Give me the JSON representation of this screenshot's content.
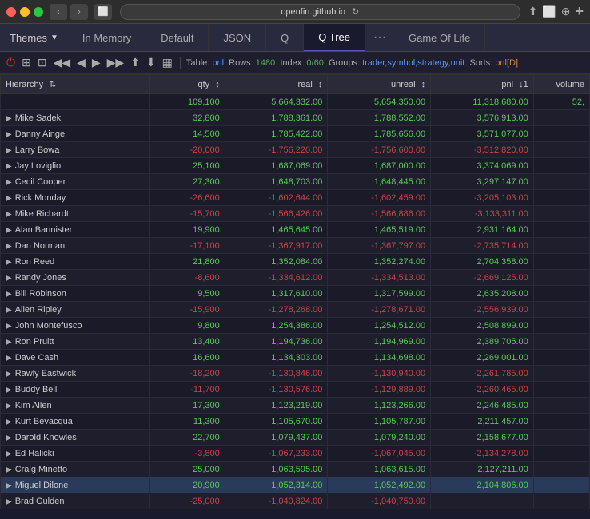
{
  "titlebar": {
    "url": "openfin.github.io",
    "nav_back": "‹",
    "nav_forward": "›"
  },
  "tabs": [
    {
      "id": "in-memory",
      "label": "In Memory",
      "active": false
    },
    {
      "id": "default",
      "label": "Default",
      "active": false
    },
    {
      "id": "json",
      "label": "JSON",
      "active": false
    },
    {
      "id": "q",
      "label": "Q",
      "active": false
    },
    {
      "id": "q-tree",
      "label": "Q Tree",
      "active": true
    },
    {
      "id": "game-of-life",
      "label": "Game Of Life",
      "active": false
    }
  ],
  "themes": {
    "label": "Themes"
  },
  "toolbar": {
    "table_label": "Table:",
    "table_name": "pnl",
    "rows_label": "Rows:",
    "rows_value": "1480",
    "index_label": "Index:",
    "index_value": "0/60",
    "groups_label": "Groups:",
    "groups_value": "trader,symbol,strategy,unit",
    "sorts_label": "Sorts:",
    "sorts_value": "pnl[D]"
  },
  "columns": [
    {
      "id": "hierarchy",
      "label": "Hierarchy",
      "sort": ""
    },
    {
      "id": "qty",
      "label": "qty",
      "sort": "↕"
    },
    {
      "id": "real",
      "label": "real",
      "sort": "↕"
    },
    {
      "id": "unreal",
      "label": "unreal",
      "sort": "↕"
    },
    {
      "id": "pnl",
      "label": "pnl",
      "sort": "↓1"
    },
    {
      "id": "volume",
      "label": "volume",
      "sort": ""
    }
  ],
  "rows": [
    {
      "hierarchy": "",
      "qty": "109,100",
      "real": "5,664,332.00",
      "unreal": "5,654,350.00",
      "pnl": "11,318,680.00",
      "volume": "52,",
      "qty_neg": false,
      "real_neg": false,
      "unreal_neg": false,
      "pnl_neg": false,
      "selected": false
    },
    {
      "hierarchy": "Mike Sadek",
      "qty": "32,800",
      "real": "1,788,361.00",
      "unreal": "1,788,552.00",
      "pnl": "3,576,913.00",
      "volume": "",
      "qty_neg": false,
      "real_neg": false,
      "unreal_neg": false,
      "pnl_neg": false,
      "selected": false
    },
    {
      "hierarchy": "Danny Ainge",
      "qty": "14,500",
      "real": "1,785,422.00",
      "unreal": "1,785,656.00",
      "pnl": "3,571,077.00",
      "volume": "",
      "qty_neg": false,
      "real_neg": false,
      "unreal_neg": false,
      "pnl_neg": false,
      "selected": false
    },
    {
      "hierarchy": "Larry Bowa",
      "qty": "-20,000",
      "real": "-1,756,220.00",
      "unreal": "-1,756,600.00",
      "pnl": "-3,512,820.00",
      "volume": "",
      "qty_neg": true,
      "real_neg": true,
      "unreal_neg": true,
      "pnl_neg": true,
      "selected": false
    },
    {
      "hierarchy": "Jay Loviglio",
      "qty": "25,100",
      "real": "1,687,069.00",
      "unreal": "1,687,000.00",
      "pnl": "3,374,069.00",
      "volume": "",
      "qty_neg": false,
      "real_neg": false,
      "unreal_neg": false,
      "pnl_neg": false,
      "selected": false
    },
    {
      "hierarchy": "Cecil Cooper",
      "qty": "27,300",
      "real": "1,648,703.00",
      "unreal": "1,648,445.00",
      "pnl": "3,297,147.00",
      "volume": "",
      "qty_neg": false,
      "real_neg": false,
      "unreal_neg": false,
      "pnl_neg": false,
      "selected": false
    },
    {
      "hierarchy": "Rick Monday",
      "qty": "-26,600",
      "real": "-1,602,644.00",
      "unreal": "-1,602,459.00",
      "pnl": "-3,205,103.00",
      "volume": "",
      "qty_neg": true,
      "real_neg": true,
      "unreal_neg": true,
      "pnl_neg": true,
      "selected": false
    },
    {
      "hierarchy": "Mike Richardt",
      "qty": "-15,700",
      "real": "-1,566,426.00",
      "unreal": "-1,566,886.00",
      "pnl": "-3,133,311.00",
      "volume": "",
      "qty_neg": true,
      "real_neg": true,
      "unreal_neg": true,
      "pnl_neg": true,
      "selected": false
    },
    {
      "hierarchy": "Alan Bannister",
      "qty": "19,900",
      "real": "1,465,645.00",
      "unreal": "1,465,519.00",
      "pnl": "2,931,164.00",
      "volume": "",
      "qty_neg": false,
      "real_neg": false,
      "unreal_neg": false,
      "pnl_neg": false,
      "selected": false
    },
    {
      "hierarchy": "Dan Norman",
      "qty": "-17,100",
      "real": "-1,367,917.00",
      "unreal": "-1,367,797.00",
      "pnl": "-2,735,714.00",
      "volume": "",
      "qty_neg": true,
      "real_neg": true,
      "unreal_neg": true,
      "pnl_neg": true,
      "selected": false
    },
    {
      "hierarchy": "Ron Reed",
      "qty": "21,800",
      "real": "1,352,084.00",
      "unreal": "1,352,274.00",
      "pnl": "2,704,358.00",
      "volume": "",
      "qty_neg": false,
      "real_neg": false,
      "unreal_neg": false,
      "pnl_neg": false,
      "selected": false
    },
    {
      "hierarchy": "Randy Jones",
      "qty": "-8,600",
      "real": "-1,334,612.00",
      "unreal": "-1,334,513.00",
      "pnl": "-2,669,125.00",
      "volume": "",
      "qty_neg": true,
      "real_neg": true,
      "unreal_neg": true,
      "pnl_neg": true,
      "selected": false
    },
    {
      "hierarchy": "Bill Robinson",
      "qty": "9,500",
      "real": "1,317,610.00",
      "unreal": "1,317,599.00",
      "pnl": "2,635,208.00",
      "volume": "",
      "qty_neg": false,
      "real_neg": false,
      "unreal_neg": false,
      "pnl_neg": false,
      "selected": false
    },
    {
      "hierarchy": "Allen Ripley",
      "qty": "-15,900",
      "real": "-1,278,268.00",
      "unreal": "-1,278,671.00",
      "pnl": "-2,556,939.00",
      "volume": "",
      "qty_neg": true,
      "real_neg": true,
      "unreal_neg": true,
      "pnl_neg": true,
      "selected": false
    },
    {
      "hierarchy": "John Montefusco",
      "qty": "9,800",
      "real": "1,254,386.00",
      "unreal": "1,254,512.00",
      "pnl": "2,508,899.00",
      "volume": "",
      "qty_neg": false,
      "real_neg": false,
      "unreal_neg": false,
      "pnl_neg": false,
      "selected": false
    },
    {
      "hierarchy": "Ron Pruitt",
      "qty": "13,400",
      "real": "1,194,736.00",
      "unreal": "1,194,969.00",
      "pnl": "2,389,705.00",
      "volume": "",
      "qty_neg": false,
      "real_neg": false,
      "unreal_neg": false,
      "pnl_neg": false,
      "selected": false
    },
    {
      "hierarchy": "Dave Cash",
      "qty": "16,600",
      "real": "1,134,303.00",
      "unreal": "1,134,698.00",
      "pnl": "2,269,001.00",
      "volume": "",
      "qty_neg": false,
      "real_neg": false,
      "unreal_neg": false,
      "pnl_neg": false,
      "selected": false
    },
    {
      "hierarchy": "Rawly Eastwick",
      "qty": "-18,200",
      "real": "-1,130,846.00",
      "unreal": "-1,130,940.00",
      "pnl": "-2,261,785.00",
      "volume": "",
      "qty_neg": true,
      "real_neg": true,
      "unreal_neg": true,
      "pnl_neg": true,
      "selected": false
    },
    {
      "hierarchy": "Buddy Bell",
      "qty": "-11,700",
      "real": "-1,130,576.00",
      "unreal": "-1,129,889.00",
      "pnl": "-2,260,465.00",
      "volume": "",
      "qty_neg": true,
      "real_neg": true,
      "unreal_neg": true,
      "pnl_neg": true,
      "selected": false
    },
    {
      "hierarchy": "Kim Allen",
      "qty": "17,300",
      "real": "1,123,219.00",
      "unreal": "1,123,266.00",
      "pnl": "2,246,485.00",
      "volume": "",
      "qty_neg": false,
      "real_neg": false,
      "unreal_neg": false,
      "pnl_neg": false,
      "selected": false
    },
    {
      "hierarchy": "Kurt Bevacqua",
      "qty": "11,300",
      "real": "1,105,670.00",
      "unreal": "1,105,787.00",
      "pnl": "2,211,457.00",
      "volume": "",
      "qty_neg": false,
      "real_neg": false,
      "unreal_neg": false,
      "pnl_neg": false,
      "selected": false
    },
    {
      "hierarchy": "Darold Knowles",
      "qty": "22,700",
      "real": "1,079,437.00",
      "unreal": "1,079,240.00",
      "pnl": "2,158,677.00",
      "volume": "",
      "qty_neg": false,
      "real_neg": false,
      "unreal_neg": false,
      "pnl_neg": false,
      "selected": false
    },
    {
      "hierarchy": "Ed Halicki",
      "qty": "-3,800",
      "real": "-1,067,233.00",
      "unreal": "-1,067,045.00",
      "pnl": "-2,134,278.00",
      "volume": "",
      "qty_neg": true,
      "real_neg": true,
      "unreal_neg": true,
      "pnl_neg": true,
      "selected": false
    },
    {
      "hierarchy": "Craig Minetto",
      "qty": "25,000",
      "real": "1,063,595.00",
      "unreal": "1,063,615.00",
      "pnl": "2,127,211.00",
      "volume": "",
      "qty_neg": false,
      "real_neg": false,
      "unreal_neg": false,
      "pnl_neg": false,
      "selected": false
    },
    {
      "hierarchy": "Miguel Dilone",
      "qty": "20,900",
      "real": "1,052,314.00",
      "unreal": "1,052,492.00",
      "pnl": "2,104,806.00",
      "volume": "",
      "qty_neg": false,
      "real_neg": false,
      "unreal_neg": false,
      "pnl_neg": false,
      "selected": true
    },
    {
      "hierarchy": "Brad Gulden",
      "qty": "-25,000",
      "real": "-1,040,824.00",
      "unreal": "-1,040,750.00",
      "pnl": "",
      "volume": "",
      "qty_neg": true,
      "real_neg": true,
      "unreal_neg": true,
      "pnl_neg": false,
      "selected": false
    }
  ]
}
